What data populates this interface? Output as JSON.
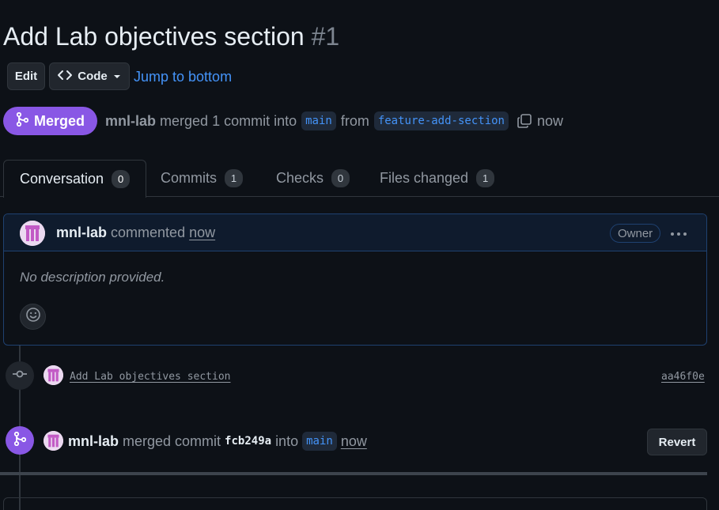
{
  "pr": {
    "title": "Add Lab objectives section",
    "number": "#1"
  },
  "actions": {
    "edit_label": "Edit",
    "code_label": "Code",
    "jump_label": "Jump to bottom"
  },
  "status": {
    "badge_label": "Merged",
    "user": "mnl-lab",
    "merged_text": "merged 1 commit into",
    "base_branch": "main",
    "from_text": "from",
    "head_branch": "feature-add-section",
    "time": "now"
  },
  "tabs": [
    {
      "label": "Conversation",
      "count": "0"
    },
    {
      "label": "Commits",
      "count": "1"
    },
    {
      "label": "Checks",
      "count": "0"
    },
    {
      "label": "Files changed",
      "count": "1"
    }
  ],
  "comment": {
    "user": "mnl-lab",
    "action": "commented",
    "time": "now",
    "role_badge": "Owner",
    "body": "No description provided."
  },
  "timeline": {
    "commit": {
      "message": "Add Lab objectives section",
      "sha": "aa46f0e"
    },
    "merge": {
      "user": "mnl-lab",
      "text": "merged commit",
      "sha": "fcb249a",
      "into_text": "into",
      "branch": "main",
      "time": "now",
      "revert_label": "Revert"
    }
  },
  "colors": {
    "background": "#0d1117",
    "merged_purple": "#8957e5",
    "link_blue": "#4493f8"
  }
}
